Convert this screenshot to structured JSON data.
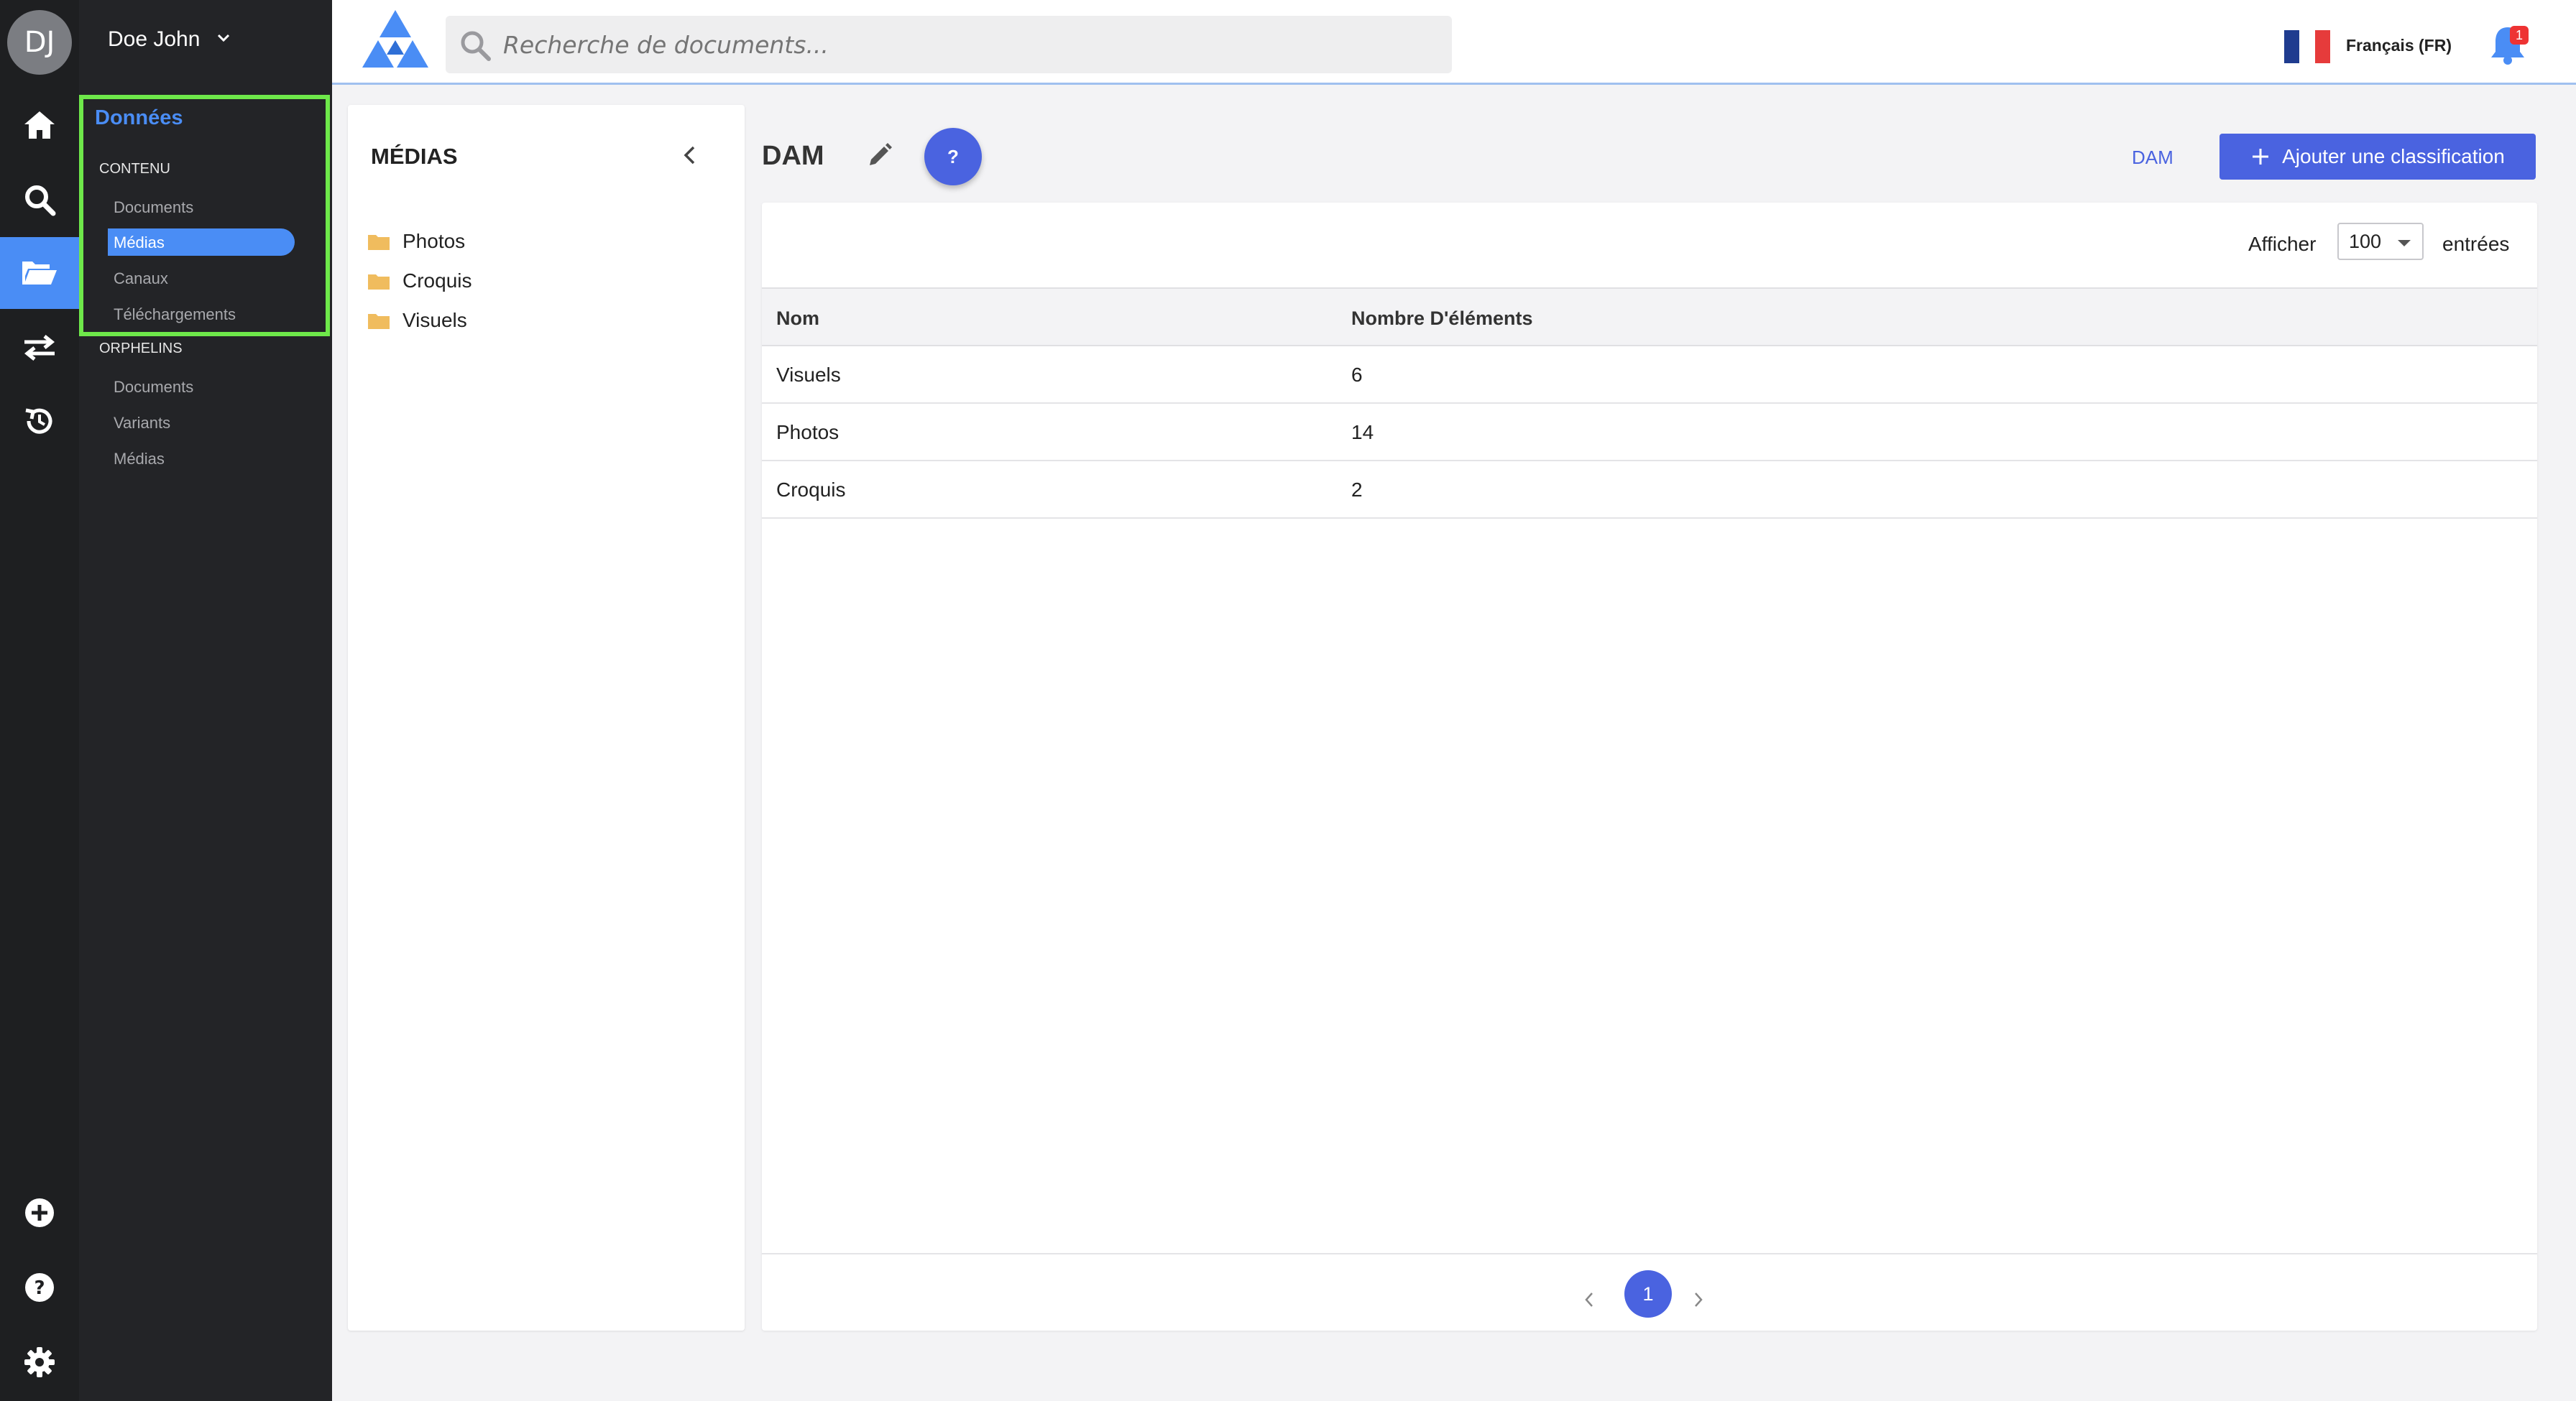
{
  "user": {
    "initials": "DJ",
    "name": "Doe John"
  },
  "rail": {
    "icons": [
      "home-icon",
      "search-icon",
      "folder-open-icon",
      "transfer-icon",
      "history-icon",
      "plus-circle-icon",
      "help-circle-icon",
      "gear-icon"
    ]
  },
  "sidebar": {
    "section_title": "Données",
    "group_content": "CONTENU",
    "content_items": [
      "Documents",
      "Médias",
      "Canaux",
      "Téléchargements"
    ],
    "selected_item": "Médias",
    "group_orphans": "ORPHELINS",
    "orphan_items": [
      "Documents",
      "Variants",
      "Médias"
    ]
  },
  "topbar": {
    "search_placeholder": "Recherche de documents...",
    "language": "Français (FR)",
    "notifications_count": "1",
    "colors": {
      "accent": "#4a63e0",
      "sidebar_active": "#4a8df5",
      "highlight": "#6ee84a"
    }
  },
  "tree": {
    "title": "MÉDIAS",
    "folders": [
      "Photos",
      "Croquis",
      "Visuels"
    ]
  },
  "main": {
    "title": "DAM",
    "help_label": "?",
    "breadcrumb": "DAM",
    "add_button": "Ajouter une classification",
    "show_label": "Afficher",
    "page_size": "100",
    "entries_label": "entrées",
    "columns": [
      "Nom",
      "Nombre D'éléments"
    ],
    "rows": [
      {
        "name": "Visuels",
        "count": "6"
      },
      {
        "name": "Photos",
        "count": "14"
      },
      {
        "name": "Croquis",
        "count": "2"
      }
    ],
    "current_page": "1"
  }
}
